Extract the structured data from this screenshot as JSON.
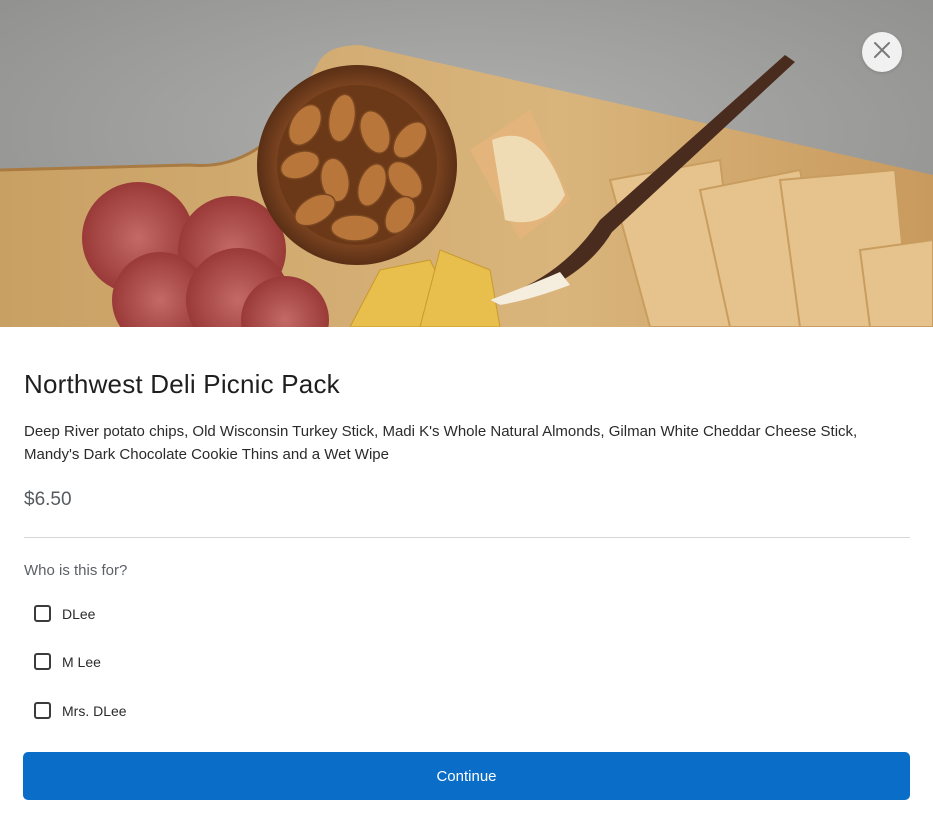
{
  "product": {
    "title": "Northwest Deli Picnic Pack",
    "description": "Deep River potato chips, Old Wisconsin Turkey Stick, Madi K's Whole Natural Almonds, Gilman White Cheddar Cheese Stick, Mandy's Dark Chocolate Cookie Thins and a Wet Wipe",
    "price": "$6.50"
  },
  "recipient": {
    "question": "Who is this for?",
    "options": [
      {
        "label": "DLee",
        "checked": false
      },
      {
        "label": "M Lee",
        "checked": false
      },
      {
        "label": "Mrs. DLee",
        "checked": false
      }
    ]
  },
  "actions": {
    "continue_label": "Continue",
    "close_icon": "close-icon"
  },
  "colors": {
    "primary": "#0a6dc8",
    "text": "#1f1f1f",
    "muted": "#5c6166"
  }
}
